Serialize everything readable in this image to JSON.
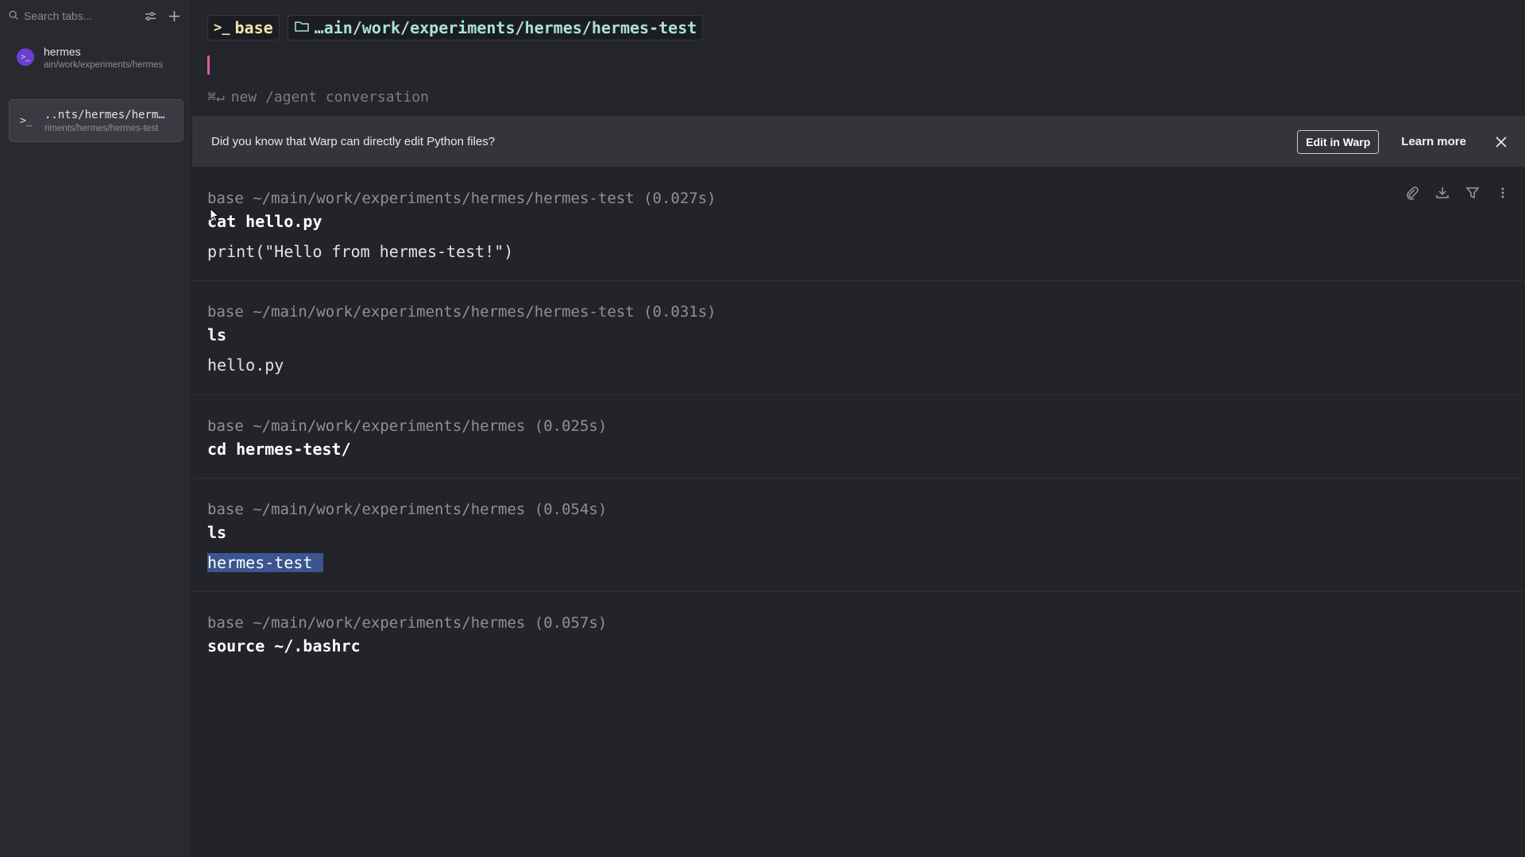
{
  "sidebar": {
    "search_placeholder": "Search tabs...",
    "tabs": [
      {
        "title": "hermes",
        "subtitle": "ain/work/experiments/hermes",
        "icon": "terminal-icon",
        "active": false
      },
      {
        "title": "..nts/hermes/herm…",
        "subtitle": "riments/hermes/hermes-test",
        "icon": "terminal-prompt-icon",
        "active": true
      }
    ]
  },
  "prompt": {
    "env_chip": "base",
    "path_chip": "…ain/work/experiments/hermes/hermes-test",
    "hint": "new /agent conversation",
    "hint_keys": "⌘↵"
  },
  "banner": {
    "text": "Did you know that Warp can directly edit Python files?",
    "edit_label": "Edit in Warp",
    "learn_label": "Learn more"
  },
  "blocks": [
    {
      "header": "base ~/main/work/experiments/hermes/hermes-test (0.027s)",
      "command": "cat hello.py",
      "output": "print(\"Hello from hermes-test!\")"
    },
    {
      "header": "base ~/main/work/experiments/hermes/hermes-test (0.031s)",
      "command": "ls",
      "output": "hello.py"
    },
    {
      "header": "base ~/main/work/experiments/hermes (0.025s)",
      "command": "cd hermes-test/",
      "output": ""
    },
    {
      "header": "base ~/main/work/experiments/hermes (0.054s)",
      "command": "ls",
      "output": "hermes-test"
    },
    {
      "header": "base ~/main/work/experiments/hermes (0.057s)",
      "command": "source ~/.bashrc",
      "output": ""
    }
  ],
  "colors": {
    "accent_cursor": "#e05aa8",
    "env_chip": "#f1e6b0",
    "path_chip": "#a9e3d6",
    "selection": "#3b5590"
  }
}
